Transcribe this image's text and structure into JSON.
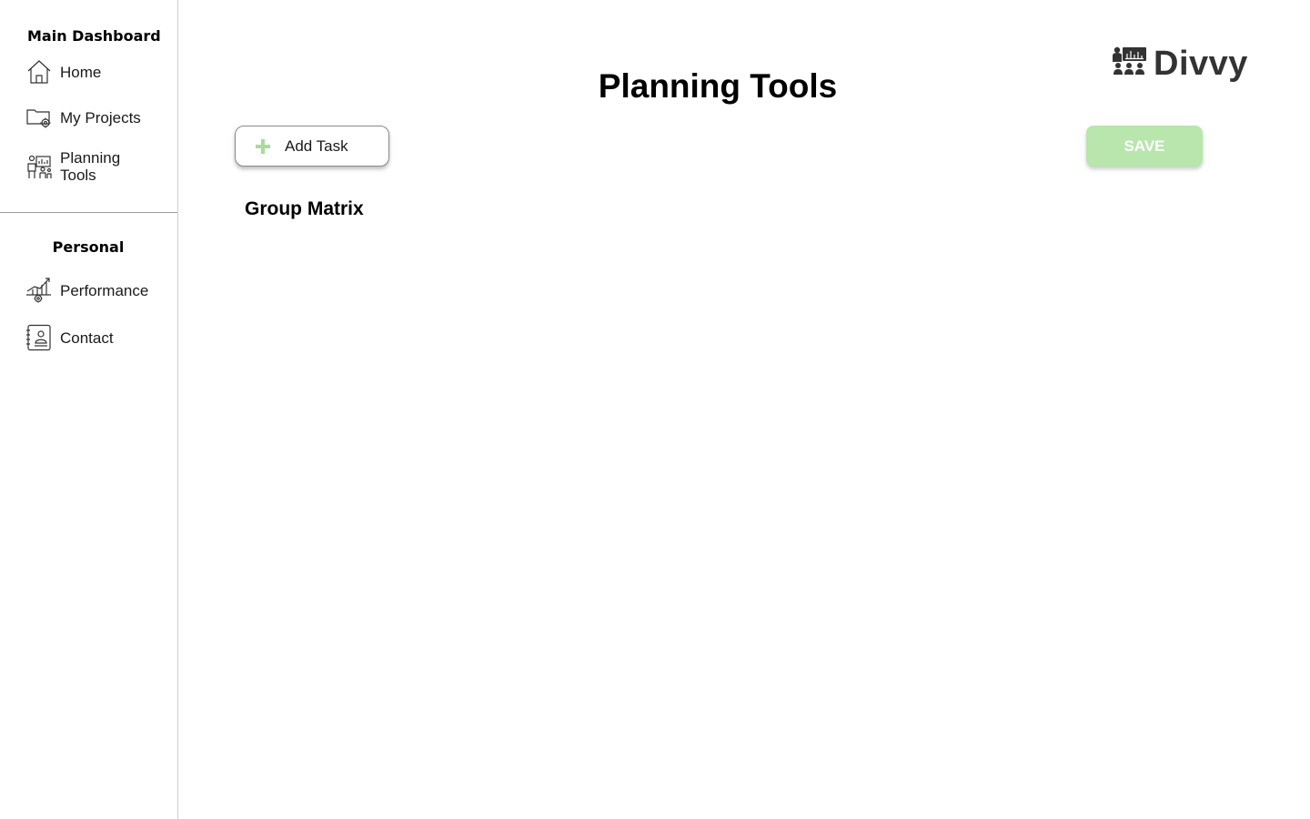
{
  "sidebar": {
    "main_title": "Main Dashboard",
    "main_items": [
      {
        "label": "Home",
        "icon": "home-icon"
      },
      {
        "label": "My Projects",
        "icon": "folder-gear-icon"
      },
      {
        "label": "Planning Tools",
        "icon": "planning-icon"
      }
    ],
    "personal_title": "Personal",
    "personal_items": [
      {
        "label": "Performance",
        "icon": "chart-gear-icon"
      },
      {
        "label": "Contact",
        "icon": "contact-book-icon"
      }
    ]
  },
  "header": {
    "title": "Planning Tools",
    "logo_text": "Divvy",
    "logo_icon": "team-presentation-icon"
  },
  "toolbar": {
    "add_task_label": "Add Task",
    "add_icon": "plus-icon",
    "save_label": "SAVE"
  },
  "main": {
    "section_heading": "Group Matrix"
  },
  "colors": {
    "accent_green": "#b8e6ad",
    "plus_green": "#a8dc9a",
    "logo_dark": "#333333"
  }
}
